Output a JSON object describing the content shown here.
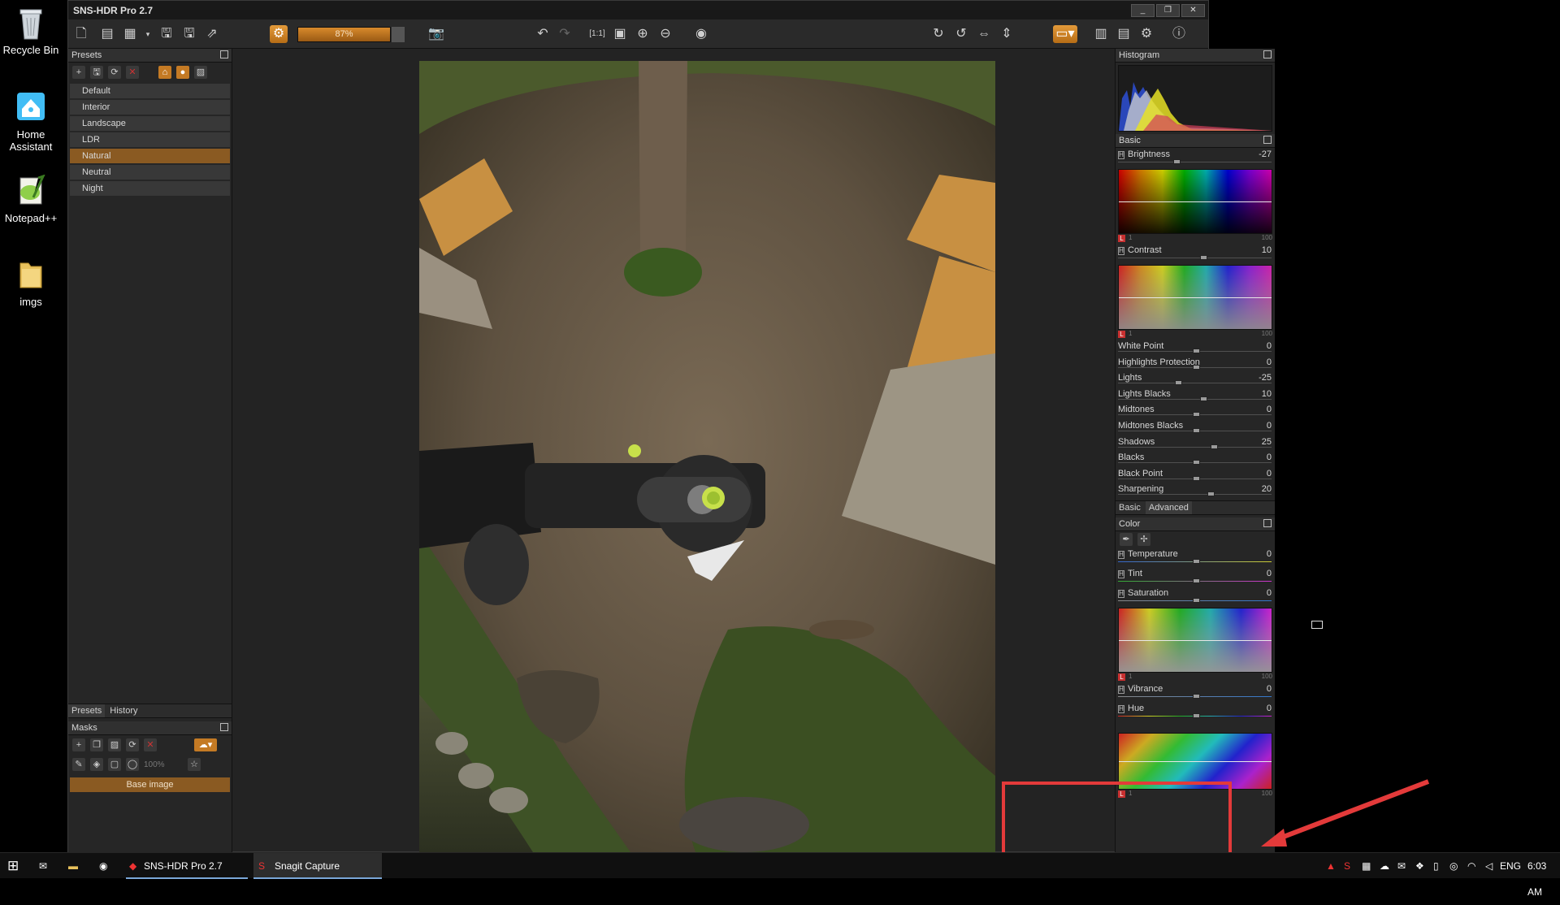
{
  "desktop": {
    "icons": [
      {
        "label": "Recycle Bin",
        "icon": "recycle-bin-icon"
      },
      {
        "label": "Home Assistant",
        "icon": "home-assistant-icon"
      },
      {
        "label": "Notepad++",
        "icon": "notepad-plus-plus-icon"
      },
      {
        "label": "imgs",
        "icon": "folder-icon"
      }
    ]
  },
  "window": {
    "title": "SNS-HDR Pro 2.7",
    "buttons": [
      "_",
      "❐",
      "✕"
    ]
  },
  "toolbar": {
    "zoom": "87%"
  },
  "presets_panel": {
    "title": "Presets",
    "items": [
      "Default",
      "Interior",
      "Landscape",
      "LDR",
      "Natural",
      "Neutral",
      "Night"
    ],
    "selected": "Natural",
    "tabs": [
      "Presets",
      "History"
    ],
    "active_tab": "Presets"
  },
  "masks_panel": {
    "title": "Masks",
    "opacity": "100%",
    "layer": "Base image"
  },
  "histogram": {
    "title": "Histogram"
  },
  "basic": {
    "title": "Basic",
    "brightness": {
      "label": "Brightness",
      "value": "-27",
      "pos": 0.37
    },
    "contrast": {
      "label": "Contrast",
      "value": "10",
      "pos": 0.55
    },
    "sliders": [
      {
        "label": "White Point",
        "value": "0",
        "pos": 0.5
      },
      {
        "label": "Highlights Protection",
        "value": "0",
        "pos": 0.5
      },
      {
        "label": "Lights",
        "value": "-25",
        "pos": 0.38
      },
      {
        "label": "Lights Blacks",
        "value": "10",
        "pos": 0.55
      },
      {
        "label": "Midtones",
        "value": "0",
        "pos": 0.5
      },
      {
        "label": "Midtones Blacks",
        "value": "0",
        "pos": 0.5
      },
      {
        "label": "Shadows",
        "value": "25",
        "pos": 0.62
      },
      {
        "label": "Blacks",
        "value": "0",
        "pos": 0.5
      },
      {
        "label": "Black Point",
        "value": "0",
        "pos": 0.5
      },
      {
        "label": "Sharpening",
        "value": "20",
        "pos": 0.6
      }
    ],
    "tabs": [
      "Basic",
      "Advanced"
    ],
    "active_tab": "Advanced"
  },
  "color": {
    "title": "Color",
    "temperature": {
      "label": "Temperature",
      "value": "0",
      "pos": 0.5
    },
    "tint": {
      "label": "Tint",
      "value": "0",
      "pos": 0.5
    },
    "saturation": {
      "label": "Saturation",
      "value": "0",
      "pos": 0.5
    },
    "vibrance": {
      "label": "Vibrance",
      "value": "0",
      "pos": 0.5
    },
    "hue": {
      "label": "Hue",
      "value": "0",
      "pos": 0.5
    }
  },
  "gradient_axis": {
    "l": "L",
    "min": "1",
    "max": "100"
  },
  "taskbar": {
    "apps": [
      "SNS-HDR Pro 2.7",
      "Snagit Capture"
    ],
    "lang": "ENG",
    "time": "6:03 AM"
  }
}
